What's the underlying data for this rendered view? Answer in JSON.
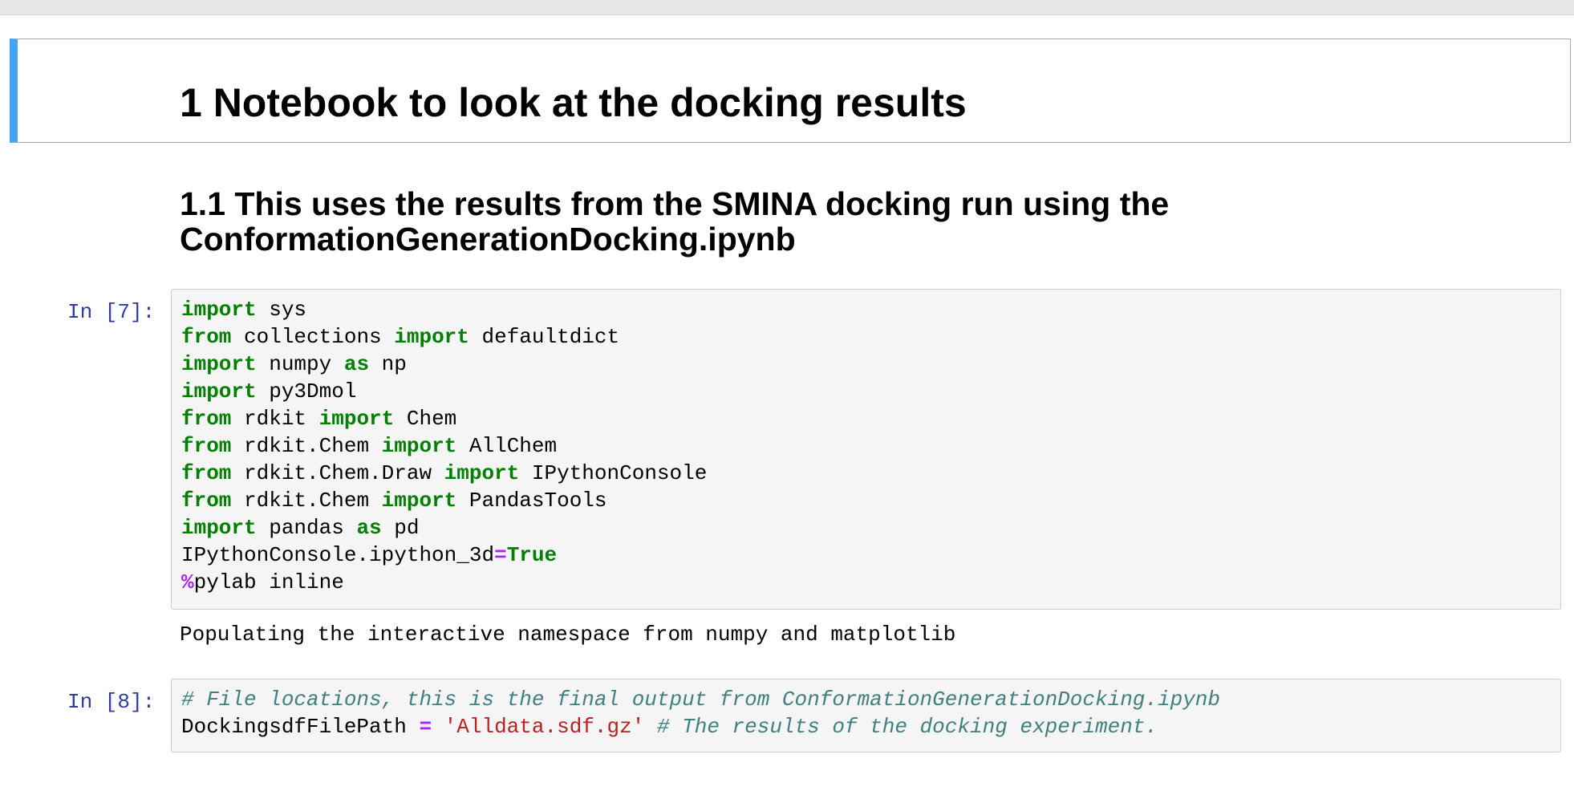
{
  "heading1": "1  Notebook to look at the docking results",
  "heading2": {
    "line1": "1.1  This uses the results from the SMINA docking run using the",
    "line2": "ConformationGenerationDocking.ipynb"
  },
  "cells": [
    {
      "prompt": "In [7]:",
      "lines": [
        [
          {
            "t": "import",
            "c": "kw"
          },
          {
            "t": " sys"
          }
        ],
        [
          {
            "t": "from",
            "c": "kw"
          },
          {
            "t": " collections "
          },
          {
            "t": "import",
            "c": "kw"
          },
          {
            "t": " defaultdict"
          }
        ],
        [
          {
            "t": "import",
            "c": "kw"
          },
          {
            "t": " numpy "
          },
          {
            "t": "as",
            "c": "kw"
          },
          {
            "t": " np"
          }
        ],
        [
          {
            "t": "import",
            "c": "kw"
          },
          {
            "t": " py3Dmol"
          }
        ],
        [
          {
            "t": "from",
            "c": "kw"
          },
          {
            "t": " rdkit "
          },
          {
            "t": "import",
            "c": "kw"
          },
          {
            "t": " Chem"
          }
        ],
        [
          {
            "t": "from",
            "c": "kw"
          },
          {
            "t": " rdkit.Chem "
          },
          {
            "t": "import",
            "c": "kw"
          },
          {
            "t": " AllChem"
          }
        ],
        [
          {
            "t": "from",
            "c": "kw"
          },
          {
            "t": " rdkit.Chem.Draw "
          },
          {
            "t": "import",
            "c": "kw"
          },
          {
            "t": " IPythonConsole"
          }
        ],
        [
          {
            "t": "from",
            "c": "kw"
          },
          {
            "t": " rdkit.Chem "
          },
          {
            "t": "import",
            "c": "kw"
          },
          {
            "t": " PandasTools"
          }
        ],
        [
          {
            "t": "import",
            "c": "kw"
          },
          {
            "t": " pandas "
          },
          {
            "t": "as",
            "c": "kw"
          },
          {
            "t": " pd"
          }
        ],
        [
          {
            "t": "IPythonConsole.ipython_3d"
          },
          {
            "t": "=",
            "c": "op"
          },
          {
            "t": "True",
            "c": "kw"
          }
        ],
        [
          {
            "t": "%",
            "c": "op"
          },
          {
            "t": "pylab inline"
          }
        ]
      ],
      "output": "Populating the interactive namespace from numpy and matplotlib"
    },
    {
      "prompt": "In [8]:",
      "lines": [
        [
          {
            "t": "# File locations, this is the final output from ConformationGenerationDocking.ipynb",
            "c": "cm"
          }
        ],
        [
          {
            "t": "DockingsdfFilePath "
          },
          {
            "t": "=",
            "c": "op"
          },
          {
            "t": " "
          },
          {
            "t": "'Alldata.sdf.gz'",
            "c": "st"
          },
          {
            "t": " "
          },
          {
            "t": "# The results of the docking experiment.",
            "c": "cm"
          }
        ]
      ]
    }
  ]
}
